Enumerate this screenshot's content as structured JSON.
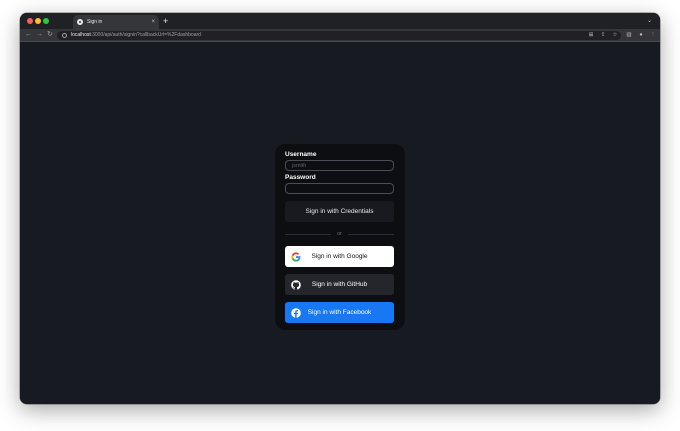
{
  "browser": {
    "tab_title": "Sign in",
    "tab_close": "×",
    "new_tab": "+",
    "url_host": "localhost",
    "url_path": ":3000/api/auth/signin?callbackUrl=%2Fdashboard"
  },
  "form": {
    "username_label": "Username",
    "username_placeholder": "jsmith",
    "username_value": "",
    "password_label": "Password",
    "password_value": "",
    "credentials_button": "Sign in with Credentials",
    "divider_text": "or",
    "google_button": "Sign in with Google",
    "github_button": "Sign in with GitHub",
    "facebook_button": "Sign in with Facebook"
  },
  "colors": {
    "page_bg": "#171a21",
    "card_bg": "#0d0e12",
    "google_bg": "#ffffff",
    "github_bg": "#24262c",
    "facebook_bg": "#1877f2"
  },
  "icons": [
    "close-icon",
    "back-arrow-icon",
    "forward-arrow-icon",
    "reload-icon",
    "site-info-icon",
    "translate-icon",
    "share-icon",
    "bookmark-star-icon",
    "side-panel-icon",
    "profile-icon",
    "menu-dots-icon",
    "google-icon",
    "github-icon",
    "facebook-icon"
  ]
}
